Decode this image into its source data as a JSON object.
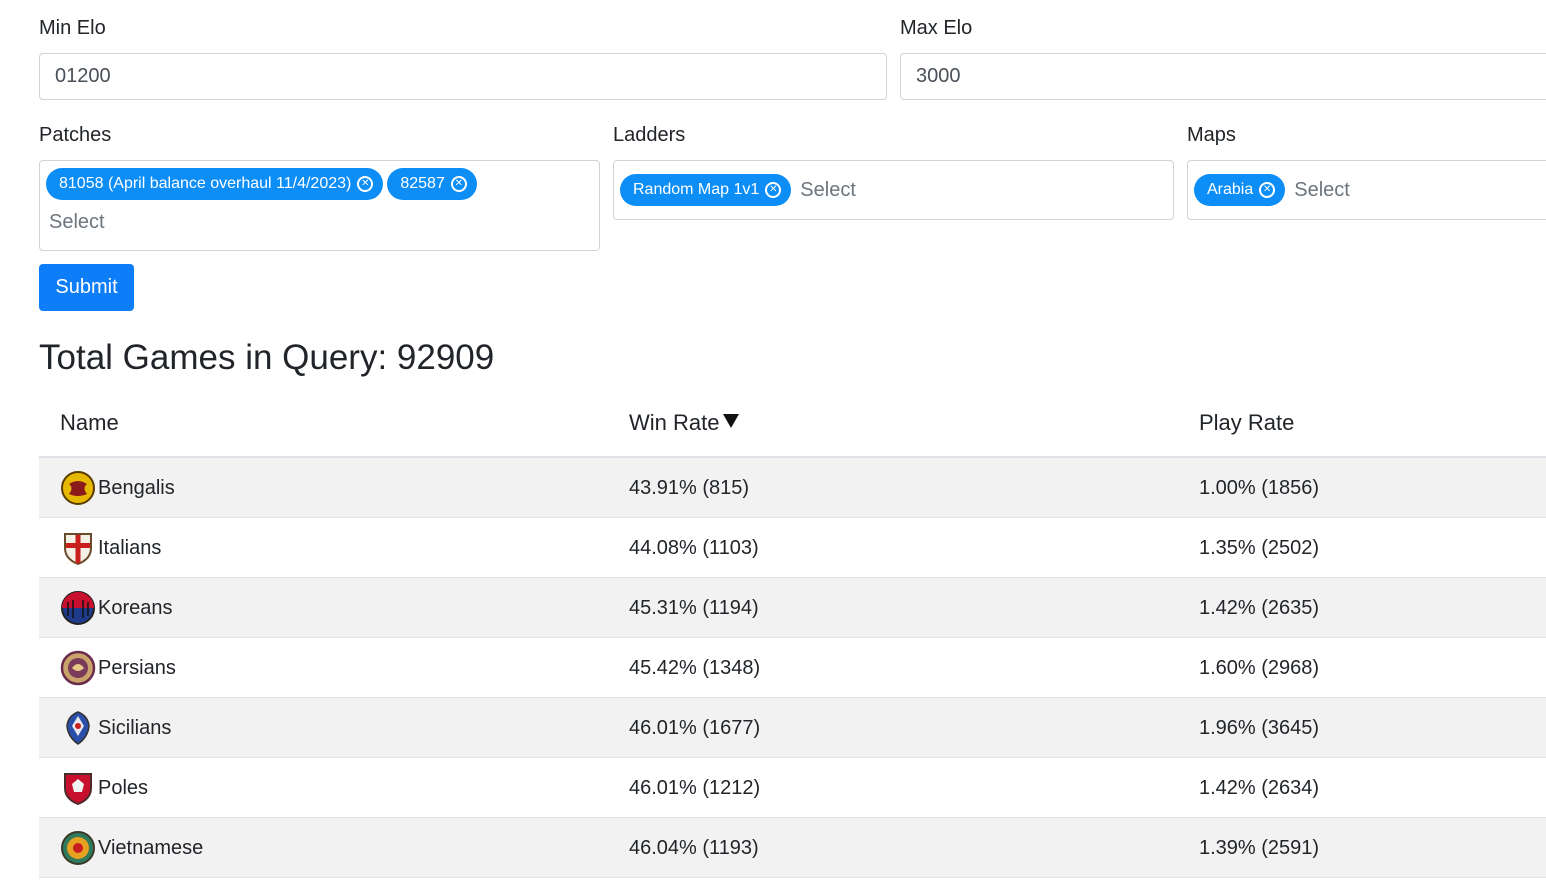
{
  "filters": {
    "min_elo": {
      "label": "Min Elo",
      "value": "01200"
    },
    "max_elo": {
      "label": "Max Elo",
      "value": "3000"
    },
    "patches": {
      "label": "Patches",
      "selected": [
        "81058 (April balance overhaul 11/4/2023)",
        "82587"
      ],
      "placeholder": "Select"
    },
    "ladders": {
      "label": "Ladders",
      "selected": [
        "Random Map 1v1"
      ],
      "placeholder": "Select"
    },
    "maps": {
      "label": "Maps",
      "selected": [
        "Arabia"
      ],
      "placeholder": "Select"
    },
    "submit_label": "Submit"
  },
  "summary": {
    "title": "Total Games in Query: 92909"
  },
  "table": {
    "headers": {
      "name": "Name",
      "win_rate": "Win Rate",
      "play_rate": "Play Rate"
    },
    "sort": {
      "column": "win_rate",
      "direction": "descending-arrow"
    },
    "rows": [
      {
        "name": "Bengalis",
        "win_rate": "43.91% (815)",
        "play_rate": "1.00% (1856)",
        "icon": "bengalis-emblem-icon"
      },
      {
        "name": "Italians",
        "win_rate": "44.08% (1103)",
        "play_rate": "1.35% (2502)",
        "icon": "italians-emblem-icon"
      },
      {
        "name": "Koreans",
        "win_rate": "45.31% (1194)",
        "play_rate": "1.42% (2635)",
        "icon": "koreans-emblem-icon"
      },
      {
        "name": "Persians",
        "win_rate": "45.42% (1348)",
        "play_rate": "1.60% (2968)",
        "icon": "persians-emblem-icon"
      },
      {
        "name": "Sicilians",
        "win_rate": "46.01% (1677)",
        "play_rate": "1.96% (3645)",
        "icon": "sicilians-emblem-icon"
      },
      {
        "name": "Poles",
        "win_rate": "46.01% (1212)",
        "play_rate": "1.42% (2634)",
        "icon": "poles-emblem-icon"
      },
      {
        "name": "Vietnamese",
        "win_rate": "46.04% (1193)",
        "play_rate": "1.39% (2591)",
        "icon": "vietnamese-emblem-icon"
      }
    ]
  },
  "colors": {
    "accent": "#0d8ef7",
    "button": "#0d7ef8",
    "stripe": "#f2f2f2",
    "border": "#dee2e6"
  }
}
